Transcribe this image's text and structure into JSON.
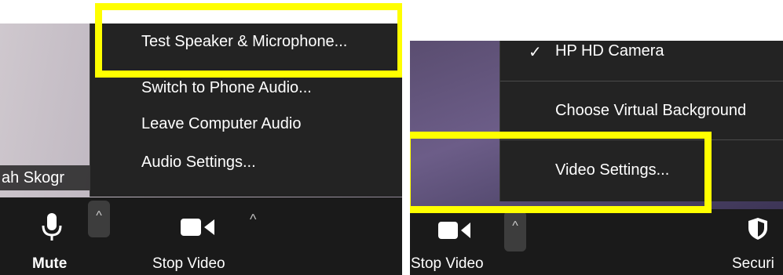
{
  "left": {
    "audio_menu": {
      "items": [
        {
          "label": "Test Speaker & Microphone..."
        },
        {
          "label": "Switch to Phone Audio..."
        },
        {
          "label": "Leave Computer Audio"
        },
        {
          "label": "Audio Settings..."
        }
      ]
    },
    "participant_name": "ah Skogr",
    "toolbar": {
      "mute_label": "Mute",
      "stop_video_label": "Stop Video",
      "caret": "^"
    }
  },
  "right": {
    "video_menu": {
      "camera_check": "✓",
      "items": [
        {
          "label": "HP HD Camera"
        },
        {
          "label": "Choose Virtual Background"
        },
        {
          "label": "Video Settings..."
        }
      ]
    },
    "toolbar": {
      "stop_video_label": "Stop Video",
      "security_label": "Securi",
      "caret": "^"
    }
  },
  "colors": {
    "highlight": "#ffff00",
    "menu_bg": "#232323",
    "toolbar_bg": "#1a1a1a"
  },
  "icons": [
    "microphone-icon",
    "video-camera-icon",
    "chevron-up-icon",
    "checkmark-icon",
    "shield-icon"
  ]
}
